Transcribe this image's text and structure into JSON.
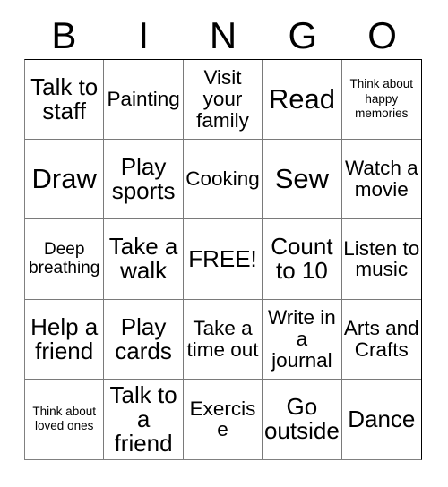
{
  "card": {
    "header_letters": [
      "B",
      "I",
      "N",
      "G",
      "O"
    ],
    "free_space_label": "FREE!",
    "colors": {
      "background": "#ffffff",
      "text": "#000000",
      "grid_line": "#7a7a7a",
      "outer_border": "#000000"
    },
    "rows": [
      [
        {
          "text": "Talk to staff",
          "size": "lg"
        },
        {
          "text": "Painting",
          "size": "md"
        },
        {
          "text": "Visit your family",
          "size": "md"
        },
        {
          "text": "Read",
          "size": "xl"
        },
        {
          "text": "Think about happy memories",
          "size": "xs"
        }
      ],
      [
        {
          "text": "Draw",
          "size": "xl"
        },
        {
          "text": "Play sports",
          "size": "lg"
        },
        {
          "text": "Cooking",
          "size": "md"
        },
        {
          "text": "Sew",
          "size": "xl"
        },
        {
          "text": "Watch a movie",
          "size": "md"
        }
      ],
      [
        {
          "text": "Deep breathing",
          "size": "sm"
        },
        {
          "text": "Take a walk",
          "size": "lg"
        },
        {
          "text": "FREE!",
          "size": "lg"
        },
        {
          "text": "Count to 10",
          "size": "lg"
        },
        {
          "text": "Listen to music",
          "size": "md"
        }
      ],
      [
        {
          "text": "Help a friend",
          "size": "lg"
        },
        {
          "text": "Play cards",
          "size": "lg"
        },
        {
          "text": "Take a time out",
          "size": "md"
        },
        {
          "text": "Write in a journal",
          "size": "md"
        },
        {
          "text": "Arts and Crafts",
          "size": "md"
        }
      ],
      [
        {
          "text": "Think about loved ones",
          "size": "xs"
        },
        {
          "text": "Talk to a friend",
          "size": "lg"
        },
        {
          "text": "Exercise",
          "size": "md"
        },
        {
          "text": "Go outside",
          "size": "lg"
        },
        {
          "text": "Dance",
          "size": "lg"
        }
      ]
    ]
  }
}
